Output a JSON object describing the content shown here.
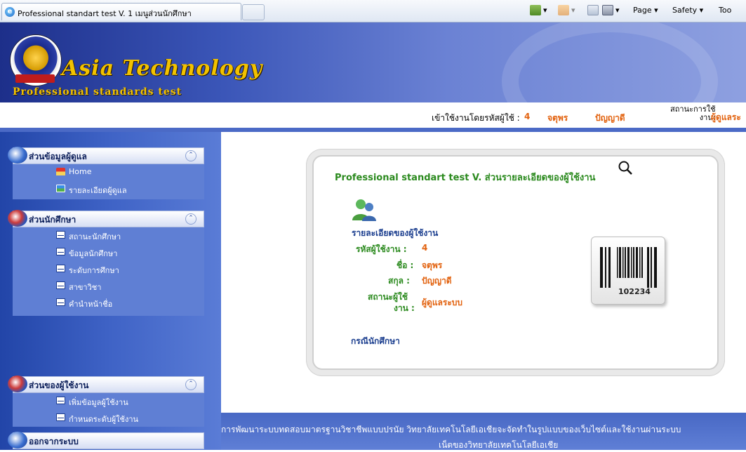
{
  "browser": {
    "tab_title": "Professional standart test V. 1 เมนูส่วนนักศึกษา",
    "commands": {
      "page": "Page ▾",
      "safety": "Safety ▾",
      "tools": "Too"
    }
  },
  "brand": {
    "title": "Asia Technology",
    "subtitle": "Professional standards test"
  },
  "user_strip": {
    "login_label": "เข้าใช้งานโดยรหัสผู้ใช้ :",
    "user_id": "4",
    "first_name": "จตุพร",
    "last_name": "ปัญญาดี",
    "status_label_line1": "สถานะการใช้",
    "status_label_line2": "งาน:",
    "status_value": "ผู้ดูแลระ"
  },
  "sidebar": {
    "panels": [
      {
        "title": "ส่วนข้อมูลผู้ดูแล",
        "items": [
          "Home",
          "รายละเอียดผู้ดูแล"
        ]
      },
      {
        "title": "ส่วนนักศึกษา",
        "items": [
          "สถานะนักศึกษา",
          "ข้อมูลนักศึกษา",
          "ระดับการศึกษา",
          "สาขาวิชา",
          "คำนำหน้าชื่อ"
        ]
      },
      {
        "title": "ส่วนของผู้ใช้งาน",
        "items": [
          "เพิ่มข้อมูลผู้ใช้งาน",
          "กำหนดระดับผู้ใช้งาน"
        ]
      },
      {
        "title": "ออกจากระบบ",
        "items": []
      }
    ]
  },
  "main": {
    "card_title": "Professional standart test V. ส่วนรายละเอียดของผู้ใช้งาน",
    "section_title": "รายละเอียดของผู้ใช้งาน",
    "fields": {
      "user_id_label": "รหัสผู้ใช้งาน :",
      "user_id_value": "4",
      "name_label": "ชื่อ :",
      "name_value": "จตุพร",
      "surname_label": "สกุล :",
      "surname_value": "ปัญญาดี",
      "status_label_1": "สถานะผู้ใช้",
      "status_label_2": "งาน :",
      "status_value": "ผู้ดูแลระบบ"
    },
    "student_link": "กรณีนักศึกษา",
    "barcode_number": "102234"
  },
  "footer": {
    "line1": "การพัฒนาระบบทดสอบมาตรฐานวิชาชีพแบบปรนัย วิทยาลัยเทคโนโลยีเอเชียจะจัดทำในรูปแบบของเว็บไซต์และใช้งานผ่านระบบ",
    "line2": "เน็ตของวิทยาลัยเทคโนโลยีเอเชีย"
  },
  "colors": {
    "sidebar_blue": "#3f63c6",
    "accent_orange": "#e2620f",
    "title_green": "#2b8a1e",
    "link_blue": "#1c3f8f"
  }
}
